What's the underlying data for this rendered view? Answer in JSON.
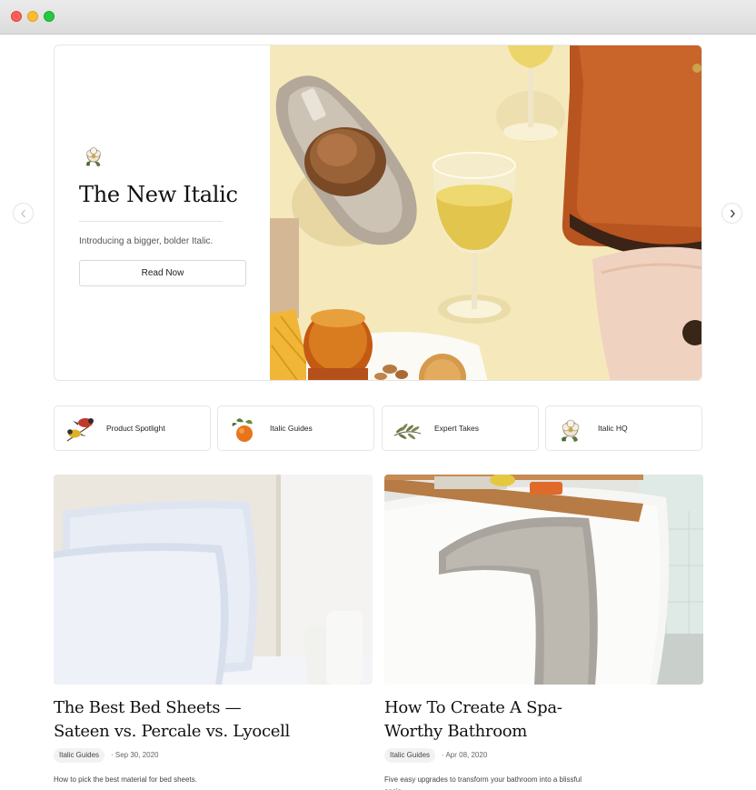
{
  "hero": {
    "title": "The New Italic",
    "subtitle": "Introducing a bigger, bolder Italic.",
    "button_label": "Read Now"
  },
  "carousel": {
    "prev_icon": "chevron-left-icon",
    "next_icon": "chevron-right-icon"
  },
  "categories": [
    {
      "label": "Product Spotlight",
      "icon": "birds-icon"
    },
    {
      "label": "Italic Guides",
      "icon": "orange-icon"
    },
    {
      "label": "Expert Takes",
      "icon": "olive-branch-icon"
    },
    {
      "label": "Italic HQ",
      "icon": "flower-icon"
    }
  ],
  "articles": [
    {
      "title_line1": "The Best Bed Sheets —",
      "title_line2": "Sateen vs. Percale vs. Lyocell",
      "tag": "Italic Guides",
      "date": "Sep 30, 2020",
      "description": "How to pick the best material for bed sheets."
    },
    {
      "title_line1": "How To Create A Spa-",
      "title_line2": "Worthy Bathroom",
      "tag": "Italic Guides",
      "date": "Apr 08, 2020",
      "description": "Five easy upgrades to transform your bathroom into a blissful oasis."
    }
  ],
  "colors": {
    "hero_bg": "#f3e6b4",
    "leather": "#b8541f",
    "accent_text": "#111111"
  }
}
